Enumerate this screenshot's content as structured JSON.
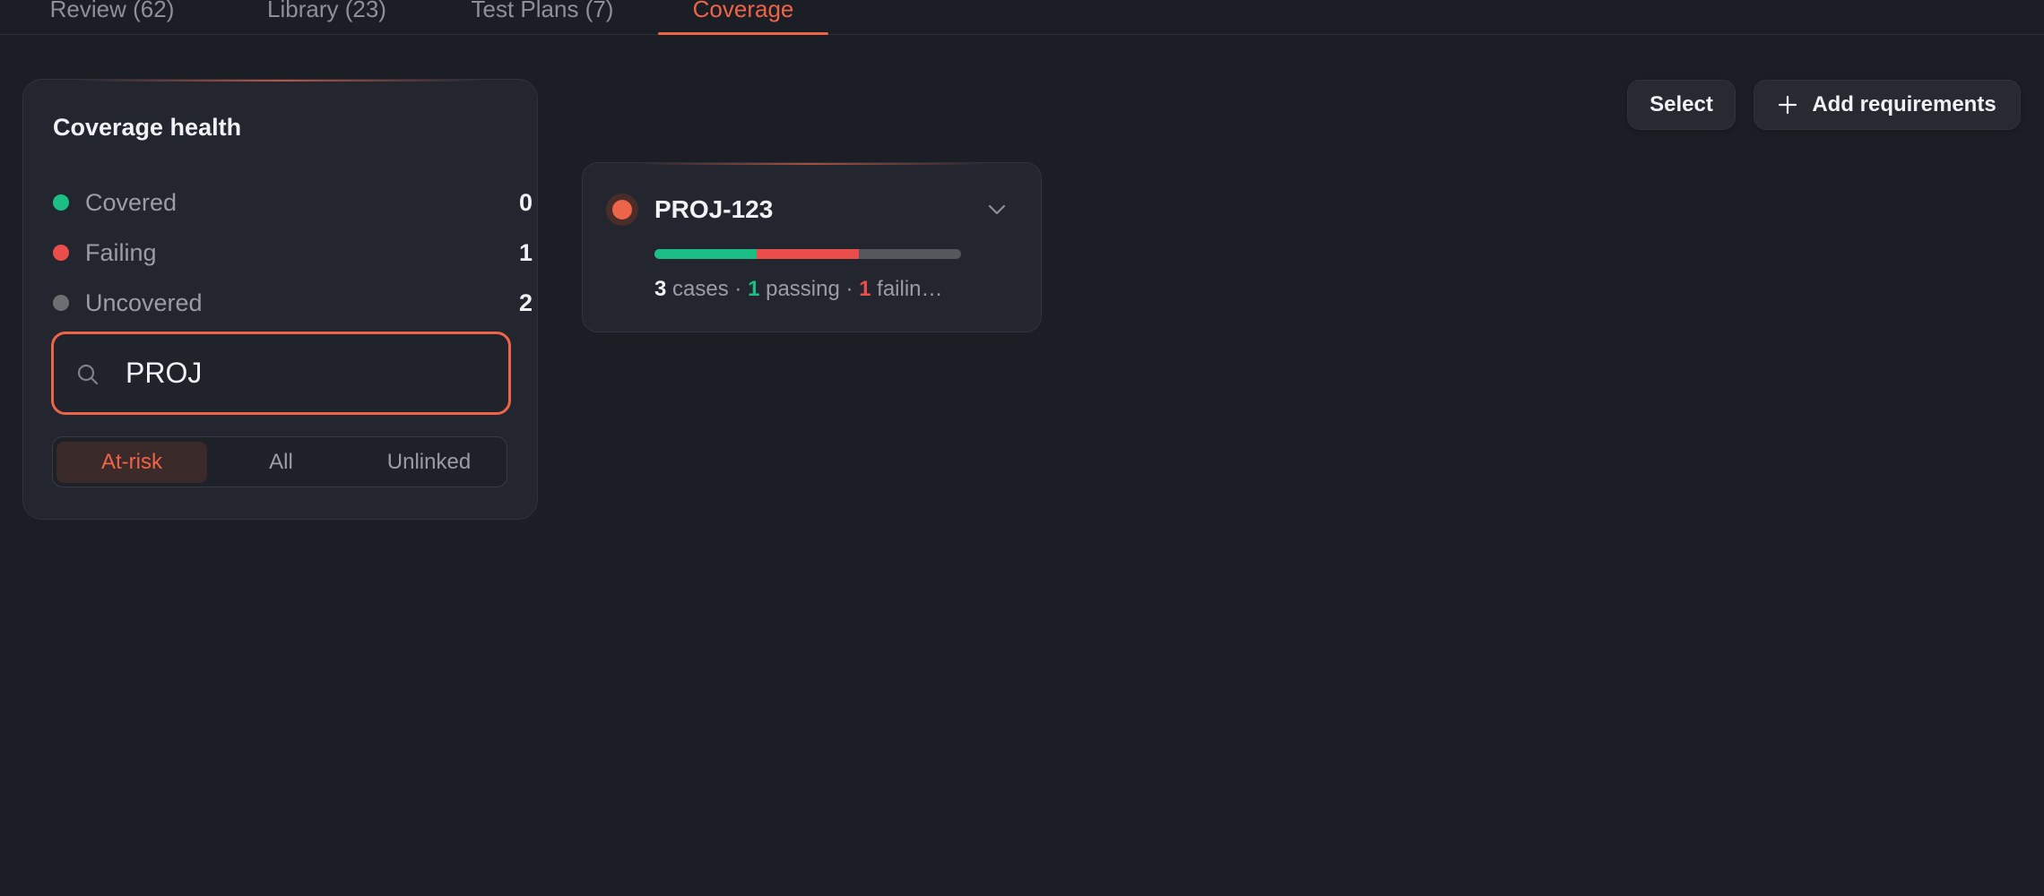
{
  "tabs": [
    {
      "label": "Review (62)",
      "active": false
    },
    {
      "label": "Library (23)",
      "active": false
    },
    {
      "label": "Test Plans (7)",
      "active": false
    },
    {
      "label": "Coverage",
      "active": true
    }
  ],
  "health": {
    "title": "Coverage health",
    "stats": [
      {
        "label": "Covered",
        "count": "0",
        "color": "#1bbf86"
      },
      {
        "label": "Failing",
        "count": "1",
        "color": "#ea4d4a"
      },
      {
        "label": "Uncovered",
        "count": "2",
        "color": "#6d6e71"
      }
    ],
    "search": {
      "value": "PROJ",
      "icon": "search-icon"
    },
    "filters": [
      {
        "label": "At-risk",
        "active": true
      },
      {
        "label": "All",
        "active": false
      },
      {
        "label": "Unlinked",
        "active": false
      }
    ]
  },
  "actions": {
    "select_label": "Select",
    "add_label": "Add requirements",
    "add_icon": "plus-icon"
  },
  "requirement": {
    "id": "PROJ-123",
    "status_color": "#ee6448",
    "total_cases": 3,
    "passing": 1,
    "failing": 1,
    "cases": "3",
    "cases_label": " cases · ",
    "passing_count": "1",
    "passing_label": " passing · ",
    "failing_count": "1",
    "failing_label": " failin…",
    "expand_icon": "chevron-down-icon"
  },
  "accent": "#ee6448"
}
